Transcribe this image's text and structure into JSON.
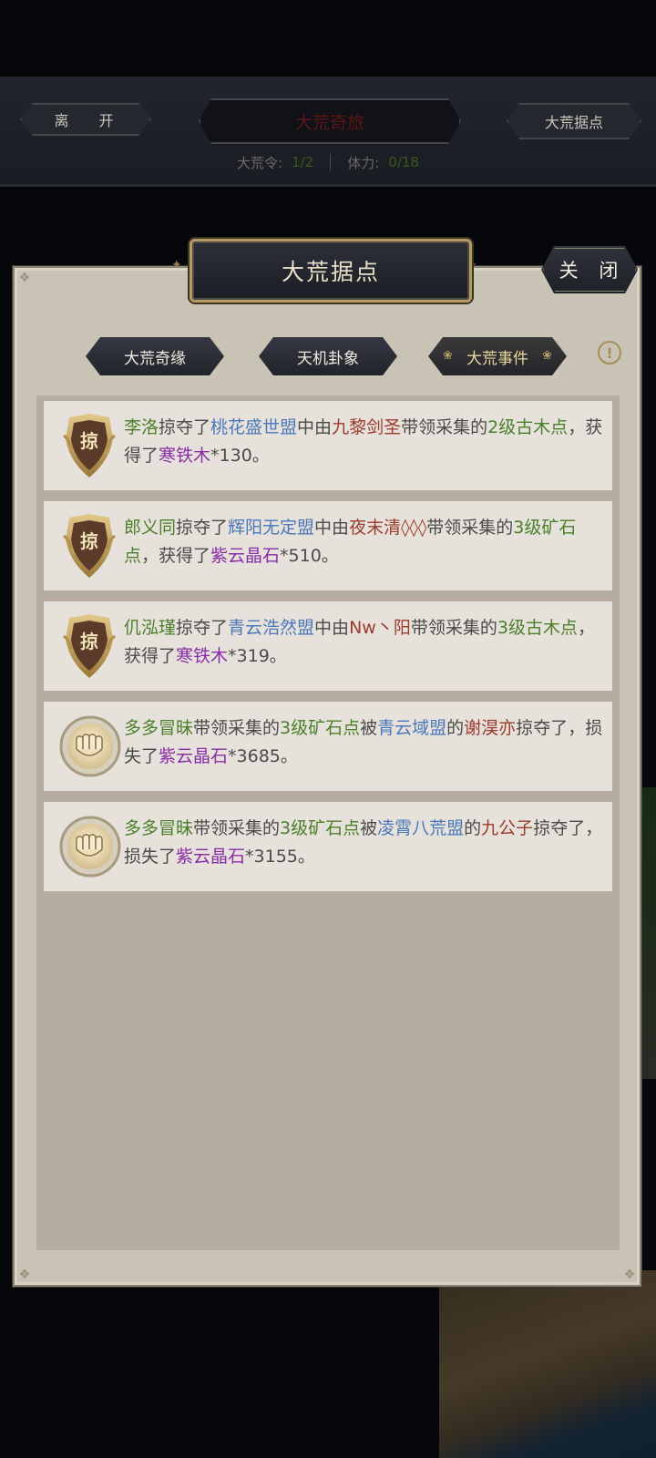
{
  "background": {
    "leave_label": "离 开",
    "title": "大荒奇旅",
    "right_label": "大荒据点",
    "stat1_label": "大荒令:",
    "stat1_value": "1/2",
    "stat2_label": "体力:",
    "stat2_value": "0/18"
  },
  "dialog": {
    "title": "大荒据点",
    "close_label": "关 闭",
    "info_icon": "!",
    "tabs": [
      {
        "label": "大荒奇缘",
        "active": false
      },
      {
        "label": "天机卦象",
        "active": false
      },
      {
        "label": "大荒事件",
        "active": true
      }
    ]
  },
  "events": [
    {
      "icon": "plunder-shield-icon",
      "icon_text": "掠",
      "segments": [
        {
          "t": "李洛",
          "c": "green"
        },
        {
          "t": "掠夺了",
          "c": "plain"
        },
        {
          "t": "桃花盛世盟",
          "c": "blue"
        },
        {
          "t": "中由",
          "c": "plain"
        },
        {
          "t": "九黎剑圣",
          "c": "red"
        },
        {
          "t": "带领采集的",
          "c": "plain"
        },
        {
          "t": "2级古木点",
          "c": "green"
        },
        {
          "t": "，获得了",
          "c": "plain"
        },
        {
          "t": "寒铁木",
          "c": "purple"
        },
        {
          "t": "*130。",
          "c": "plain"
        }
      ]
    },
    {
      "icon": "plunder-shield-icon",
      "icon_text": "掠",
      "segments": [
        {
          "t": "郎义同",
          "c": "green"
        },
        {
          "t": "掠夺了",
          "c": "plain"
        },
        {
          "t": "辉阳无定盟",
          "c": "blue"
        },
        {
          "t": "中由",
          "c": "plain"
        },
        {
          "t": "夜末清◊◊◊",
          "c": "red"
        },
        {
          "t": "带领采集的",
          "c": "plain"
        },
        {
          "t": "3级矿石点",
          "c": "green"
        },
        {
          "t": "，获得了",
          "c": "plain"
        },
        {
          "t": "紫云晶石",
          "c": "purple"
        },
        {
          "t": "*510。",
          "c": "plain"
        }
      ]
    },
    {
      "icon": "plunder-shield-icon",
      "icon_text": "掠",
      "segments": [
        {
          "t": "仉泓瑾",
          "c": "green"
        },
        {
          "t": "掠夺了",
          "c": "plain"
        },
        {
          "t": "青云浩然盟",
          "c": "blue"
        },
        {
          "t": "中由",
          "c": "plain"
        },
        {
          "t": "Nw丶阳",
          "c": "red"
        },
        {
          "t": "带领采集的",
          "c": "plain"
        },
        {
          "t": "3级古木点",
          "c": "green"
        },
        {
          "t": "，获得了",
          "c": "plain"
        },
        {
          "t": "寒铁木",
          "c": "purple"
        },
        {
          "t": "*319。",
          "c": "plain"
        }
      ]
    },
    {
      "icon": "fist-icon",
      "icon_text": "",
      "segments": [
        {
          "t": "多多冒昧",
          "c": "green"
        },
        {
          "t": "带领采集的",
          "c": "plain"
        },
        {
          "t": "3级矿石点",
          "c": "green"
        },
        {
          "t": "被",
          "c": "plain"
        },
        {
          "t": "青云域盟",
          "c": "blue"
        },
        {
          "t": "的",
          "c": "plain"
        },
        {
          "t": "谢淏亦",
          "c": "red"
        },
        {
          "t": "掠夺了，损失了",
          "c": "plain"
        },
        {
          "t": "紫云晶石",
          "c": "purple"
        },
        {
          "t": "*3685。",
          "c": "plain"
        }
      ]
    },
    {
      "icon": "fist-icon",
      "icon_text": "",
      "segments": [
        {
          "t": "多多冒昧",
          "c": "green"
        },
        {
          "t": "带领采集的",
          "c": "plain"
        },
        {
          "t": "3级矿石点",
          "c": "green"
        },
        {
          "t": "被",
          "c": "plain"
        },
        {
          "t": "凌霄八荒盟",
          "c": "blue"
        },
        {
          "t": "的",
          "c": "plain"
        },
        {
          "t": "九公子",
          "c": "red"
        },
        {
          "t": "掠夺了，损失了",
          "c": "plain"
        },
        {
          "t": "紫云晶石",
          "c": "purple"
        },
        {
          "t": "*3155。",
          "c": "plain"
        }
      ]
    }
  ],
  "colors": {
    "green": "#4b7f2a",
    "blue": "#4b78b8",
    "red": "#9b3a2a",
    "purple": "#8a2ea6"
  }
}
